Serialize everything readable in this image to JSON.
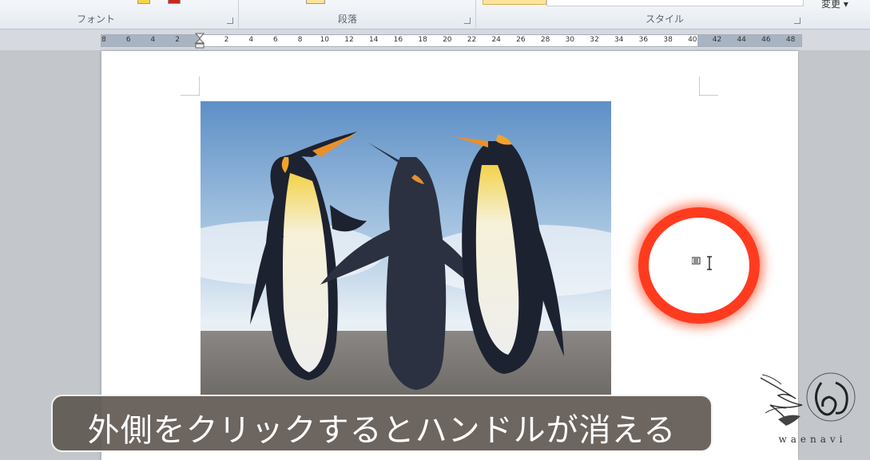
{
  "ribbon": {
    "groups": [
      {
        "label": "フォント"
      },
      {
        "label": "段落"
      },
      {
        "label": "スタイル"
      }
    ],
    "change_button": "変更 ▾"
  },
  "ruler": {
    "labels": [
      "8",
      "6",
      "4",
      "2",
      "",
      "2",
      "4",
      "6",
      "8",
      "10",
      "12",
      "14",
      "16",
      "18",
      "20",
      "22",
      "24",
      "26",
      "28",
      "30",
      "32",
      "34",
      "36",
      "38",
      "40",
      "42",
      "44",
      "46",
      "48"
    ]
  },
  "caption": {
    "text": "外側をクリックするとハンドルが消える"
  },
  "watermark": {
    "text": "waenavi"
  },
  "colors": {
    "highlight": "#ff3b1f",
    "caption_bg": "#5f5852"
  }
}
